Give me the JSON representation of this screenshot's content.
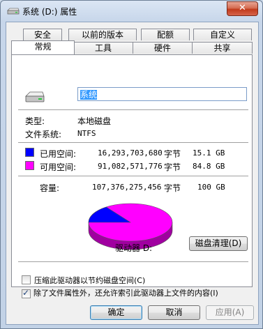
{
  "window": {
    "title": "系统 (D:) 属性",
    "close_glyph": "✕"
  },
  "tabs_back": [
    "安全",
    "以前的版本",
    "配额",
    "自定义"
  ],
  "tabs_front": [
    "常规",
    "工具",
    "硬件",
    "共享"
  ],
  "general": {
    "name_value": "系统",
    "type_label": "类型:",
    "type_value": "本地磁盘",
    "fs_label": "文件系统:",
    "fs_value": "NTFS",
    "used": {
      "label": "已用空间:",
      "bytes": "16,293,703,680",
      "unit": "字节",
      "size": "15.1 GB",
      "color": "#0000ff"
    },
    "free": {
      "label": "可用空间:",
      "bytes": "91,082,571,776",
      "unit": "字节",
      "size": "84.8 GB",
      "color": "#ff00ff"
    },
    "capacity": {
      "label": "容量:",
      "bytes": "107,376,275,456",
      "unit": "字节",
      "size": "100 GB"
    },
    "drive_label": "驱动器 D:",
    "cleanup_button": "磁盘清理(D)",
    "compress_label": "压缩此驱动器以节约磁盘空间(C)",
    "compress_checked": false,
    "index_label": "除了文件属性外，还允许索引此驱动器上文件的内容(I)",
    "index_checked": true,
    "used_fraction": 0.1517
  },
  "buttons": {
    "ok": "确定",
    "cancel": "取消",
    "apply": "应用(A)"
  }
}
